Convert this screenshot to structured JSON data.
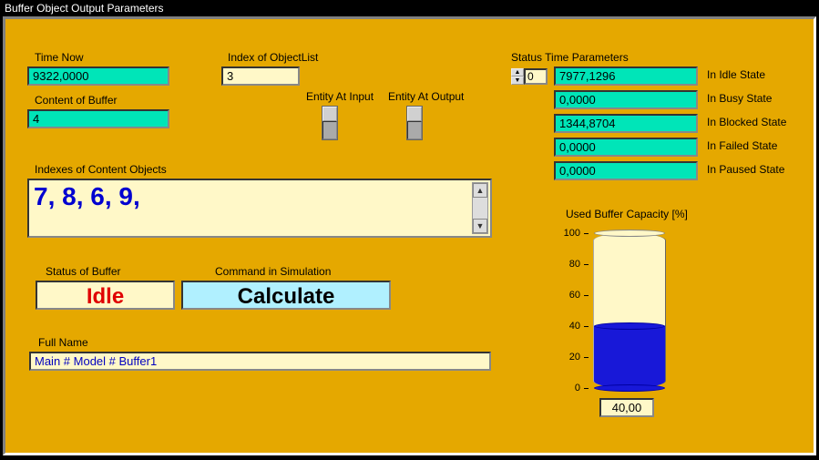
{
  "title": "Buffer Object Output Parameters",
  "timeNow": {
    "label": "Time Now",
    "value": "9322,0000"
  },
  "contentBuffer": {
    "label": "Content of Buffer",
    "value": "4"
  },
  "indexObjectList": {
    "label": "Index of ObjectList",
    "value": "3"
  },
  "entityInput": {
    "label": "Entity At Input"
  },
  "entityOutput": {
    "label": "Entity At Output"
  },
  "indexesContent": {
    "label": "Indexes of Content Objects",
    "value": "7, 8, 6, 9,"
  },
  "statusBuffer": {
    "label": "Status of Buffer",
    "value": "Idle"
  },
  "command": {
    "label": "Command in Simulation",
    "value": "Calculate"
  },
  "fullName": {
    "label": "Full Name",
    "value": "Main # Model # Buffer1"
  },
  "statusTime": {
    "label": "Status Time Parameters",
    "spinner": "0",
    "rows": [
      {
        "value": "7977,1296",
        "label": "In Idle State"
      },
      {
        "value": "0,0000",
        "label": "In Busy State"
      },
      {
        "value": "1344,8704",
        "label": "In Blocked State"
      },
      {
        "value": "0,0000",
        "label": "In Failed State"
      },
      {
        "value": "0,0000",
        "label": "In Paused State"
      }
    ]
  },
  "chart": {
    "label": "Used Buffer Capacity [%]",
    "value_label": "40,00"
  },
  "chart_data": {
    "type": "bar",
    "categories": [
      "Used Buffer Capacity"
    ],
    "values": [
      40
    ],
    "title": "Used Buffer Capacity [%]",
    "xlabel": "",
    "ylabel": "%",
    "ylim": [
      0,
      100
    ],
    "ticks": [
      0,
      20,
      40,
      60,
      80,
      100
    ]
  }
}
